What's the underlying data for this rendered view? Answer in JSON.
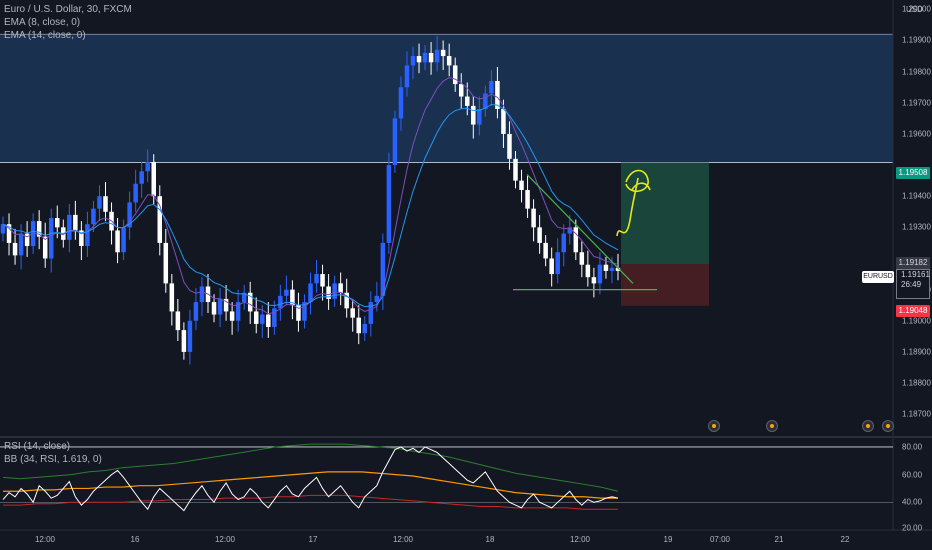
{
  "legend": {
    "title": "Euro / U.S. Dollar, 30, FXCM",
    "ema1": "EMA (8, close, 0)",
    "ema2": "EMA (14, close, 0)",
    "rsi": "RSI (14, close)",
    "bb": "BB (34, RSI, 1.619, 0)"
  },
  "price_axis": {
    "currency": "USD",
    "labels": [
      "1.20000",
      "1.19900",
      "1.19800",
      "1.19700",
      "1.19600",
      "1.19400",
      "1.19300",
      "1.19100",
      "1.19000",
      "1.18900",
      "1.18800",
      "1.18700"
    ]
  },
  "price_tags": {
    "target": "1.19508",
    "entry": "1.19182",
    "stop": "1.19048",
    "symbol": "EURUSD",
    "last_price": "1.19161",
    "countdown": "26:49"
  },
  "rsi_axis": {
    "labels": [
      "80.00",
      "60.00",
      "40.00",
      "20.00"
    ]
  },
  "time_axis": {
    "labels": [
      "12:00",
      "16",
      "12:00",
      "17",
      "12:00",
      "18",
      "12:00",
      "19",
      "07:00",
      "21",
      "22"
    ]
  },
  "colors": {
    "background": "#131722",
    "candle_up": "#2962ff",
    "candle_down": "#ffffff",
    "ema_fast": "#7b4fbf",
    "ema_slow": "#2196f3",
    "resistance_zone": "#1e3a5f",
    "target_zone": "#1b4d3e",
    "stop_zone": "#4a1f24",
    "trendline": "#4caf50",
    "arrow": "#e6e61a",
    "rsi_line": "#ffffff",
    "bb_upper": "#2e7d32",
    "bb_basis": "#ff9800",
    "bb_lower": "#c62828",
    "tag_green": "#089981",
    "tag_red": "#f23645"
  },
  "chart_data": {
    "type": "candlestick",
    "timeframe": "30",
    "y_range": [
      1.1863,
      1.2003
    ],
    "series": [
      {
        "name": "EMA (8, close, 0)"
      },
      {
        "name": "EMA (14, close, 0)"
      }
    ],
    "close_path": [
      1.1931,
      1.1925,
      1.1921,
      1.1928,
      1.1924,
      1.1932,
      1.1927,
      1.192,
      1.1933,
      1.193,
      1.1926,
      1.1934,
      1.1929,
      1.1924,
      1.1931,
      1.1936,
      1.194,
      1.1935,
      1.1929,
      1.1922,
      1.193,
      1.1938,
      1.1944,
      1.1948,
      1.1951,
      1.194,
      1.1925,
      1.1912,
      1.1903,
      1.1897,
      1.189,
      1.19,
      1.1906,
      1.1911,
      1.1906,
      1.1902,
      1.1907,
      1.1903,
      1.19,
      1.1906,
      1.1909,
      1.1903,
      1.1899,
      1.1902,
      1.1898,
      1.1904,
      1.1908,
      1.191,
      1.1905,
      1.19,
      1.1906,
      1.1912,
      1.1915,
      1.1911,
      1.1907,
      1.1912,
      1.1909,
      1.1904,
      1.1901,
      1.1896,
      1.1899,
      1.1906,
      1.1908,
      1.1925,
      1.195,
      1.1965,
      1.1975,
      1.1982,
      1.1985,
      1.1983,
      1.1986,
      1.1983,
      1.1987,
      1.1985,
      1.1982,
      1.1976,
      1.1972,
      1.1969,
      1.1963,
      1.1968,
      1.1973,
      1.1977,
      1.1968,
      1.196,
      1.1952,
      1.1945,
      1.1942,
      1.1936,
      1.193,
      1.1925,
      1.192,
      1.1915,
      1.1922,
      1.1928,
      1.193,
      1.1922,
      1.1918,
      1.1914,
      1.1912,
      1.1918,
      1.1916,
      1.1917,
      1.1916
    ],
    "target_level": 1.19508,
    "entry_level": 1.19182,
    "stop_level": 1.19048,
    "rsi": {
      "y_range": [
        20,
        85
      ],
      "bands": [
        80,
        40
      ],
      "values": [
        42,
        47,
        44,
        50,
        46,
        40,
        52,
        48,
        43,
        45,
        50,
        55,
        44,
        38,
        42,
        48,
        52,
        56,
        60,
        63,
        58,
        52,
        46,
        40,
        35,
        44,
        50,
        46,
        42,
        38,
        34,
        41,
        47,
        52,
        45,
        40,
        48,
        54,
        46,
        42,
        44,
        50,
        46,
        40,
        36,
        42,
        48,
        52,
        46,
        44,
        50,
        54,
        58,
        50,
        44,
        48,
        52,
        46,
        40,
        36,
        44,
        48,
        52,
        62,
        70,
        78,
        80,
        77,
        79,
        76,
        80,
        78,
        76,
        72,
        68,
        64,
        60,
        56,
        54,
        58,
        62,
        55,
        48,
        44,
        40,
        38,
        36,
        42,
        46,
        40,
        38,
        36,
        40,
        44,
        48,
        42,
        38,
        42,
        40,
        41,
        43,
        44,
        43
      ],
      "basis": [
        48,
        48,
        49,
        49,
        50,
        50,
        51,
        51,
        52,
        52,
        53,
        54,
        55,
        56,
        57,
        58,
        59,
        60,
        61,
        62,
        62,
        62,
        61,
        60,
        59,
        57,
        55,
        53,
        51,
        49,
        47,
        46,
        45,
        44,
        44,
        43,
        43
      ],
      "upper": [
        58,
        57,
        58,
        59,
        60,
        62,
        63,
        65,
        66,
        67,
        68,
        70,
        72,
        74,
        76,
        78,
        80,
        81,
        82,
        82,
        82,
        81,
        80,
        79,
        77,
        75,
        73,
        70,
        67,
        64,
        61,
        59,
        57,
        55,
        53,
        51,
        48
      ],
      "lower": [
        38,
        38,
        39,
        39,
        40,
        40,
        40,
        40,
        41,
        41,
        42,
        42,
        42,
        43,
        43,
        43,
        44,
        44,
        45,
        45,
        45,
        44,
        43,
        42,
        41,
        40,
        39,
        38,
        37,
        37,
        36,
        36,
        36,
        36,
        35,
        35,
        35
      ]
    }
  }
}
